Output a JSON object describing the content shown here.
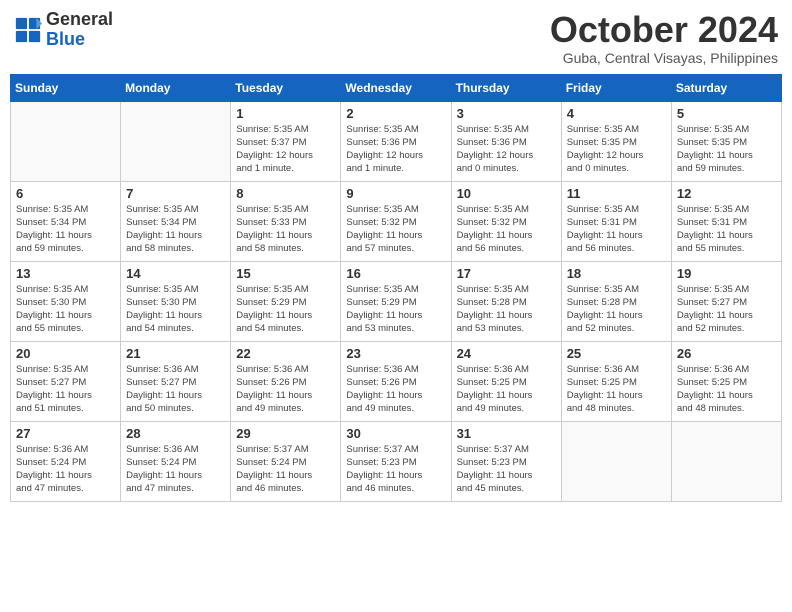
{
  "header": {
    "logo": {
      "general": "General",
      "blue": "Blue"
    },
    "title": "October 2024",
    "subtitle": "Guba, Central Visayas, Philippines"
  },
  "weekdays": [
    "Sunday",
    "Monday",
    "Tuesday",
    "Wednesday",
    "Thursday",
    "Friday",
    "Saturday"
  ],
  "weeks": [
    [
      {
        "day": "",
        "info": ""
      },
      {
        "day": "",
        "info": ""
      },
      {
        "day": "1",
        "info": "Sunrise: 5:35 AM\nSunset: 5:37 PM\nDaylight: 12 hours\nand 1 minute."
      },
      {
        "day": "2",
        "info": "Sunrise: 5:35 AM\nSunset: 5:36 PM\nDaylight: 12 hours\nand 1 minute."
      },
      {
        "day": "3",
        "info": "Sunrise: 5:35 AM\nSunset: 5:36 PM\nDaylight: 12 hours\nand 0 minutes."
      },
      {
        "day": "4",
        "info": "Sunrise: 5:35 AM\nSunset: 5:35 PM\nDaylight: 12 hours\nand 0 minutes."
      },
      {
        "day": "5",
        "info": "Sunrise: 5:35 AM\nSunset: 5:35 PM\nDaylight: 11 hours\nand 59 minutes."
      }
    ],
    [
      {
        "day": "6",
        "info": "Sunrise: 5:35 AM\nSunset: 5:34 PM\nDaylight: 11 hours\nand 59 minutes."
      },
      {
        "day": "7",
        "info": "Sunrise: 5:35 AM\nSunset: 5:34 PM\nDaylight: 11 hours\nand 58 minutes."
      },
      {
        "day": "8",
        "info": "Sunrise: 5:35 AM\nSunset: 5:33 PM\nDaylight: 11 hours\nand 58 minutes."
      },
      {
        "day": "9",
        "info": "Sunrise: 5:35 AM\nSunset: 5:32 PM\nDaylight: 11 hours\nand 57 minutes."
      },
      {
        "day": "10",
        "info": "Sunrise: 5:35 AM\nSunset: 5:32 PM\nDaylight: 11 hours\nand 56 minutes."
      },
      {
        "day": "11",
        "info": "Sunrise: 5:35 AM\nSunset: 5:31 PM\nDaylight: 11 hours\nand 56 minutes."
      },
      {
        "day": "12",
        "info": "Sunrise: 5:35 AM\nSunset: 5:31 PM\nDaylight: 11 hours\nand 55 minutes."
      }
    ],
    [
      {
        "day": "13",
        "info": "Sunrise: 5:35 AM\nSunset: 5:30 PM\nDaylight: 11 hours\nand 55 minutes."
      },
      {
        "day": "14",
        "info": "Sunrise: 5:35 AM\nSunset: 5:30 PM\nDaylight: 11 hours\nand 54 minutes."
      },
      {
        "day": "15",
        "info": "Sunrise: 5:35 AM\nSunset: 5:29 PM\nDaylight: 11 hours\nand 54 minutes."
      },
      {
        "day": "16",
        "info": "Sunrise: 5:35 AM\nSunset: 5:29 PM\nDaylight: 11 hours\nand 53 minutes."
      },
      {
        "day": "17",
        "info": "Sunrise: 5:35 AM\nSunset: 5:28 PM\nDaylight: 11 hours\nand 53 minutes."
      },
      {
        "day": "18",
        "info": "Sunrise: 5:35 AM\nSunset: 5:28 PM\nDaylight: 11 hours\nand 52 minutes."
      },
      {
        "day": "19",
        "info": "Sunrise: 5:35 AM\nSunset: 5:27 PM\nDaylight: 11 hours\nand 52 minutes."
      }
    ],
    [
      {
        "day": "20",
        "info": "Sunrise: 5:35 AM\nSunset: 5:27 PM\nDaylight: 11 hours\nand 51 minutes."
      },
      {
        "day": "21",
        "info": "Sunrise: 5:36 AM\nSunset: 5:27 PM\nDaylight: 11 hours\nand 50 minutes."
      },
      {
        "day": "22",
        "info": "Sunrise: 5:36 AM\nSunset: 5:26 PM\nDaylight: 11 hours\nand 49 minutes."
      },
      {
        "day": "23",
        "info": "Sunrise: 5:36 AM\nSunset: 5:26 PM\nDaylight: 11 hours\nand 49 minutes."
      },
      {
        "day": "24",
        "info": "Sunrise: 5:36 AM\nSunset: 5:25 PM\nDaylight: 11 hours\nand 49 minutes."
      },
      {
        "day": "25",
        "info": "Sunrise: 5:36 AM\nSunset: 5:25 PM\nDaylight: 11 hours\nand 48 minutes."
      },
      {
        "day": "26",
        "info": "Sunrise: 5:36 AM\nSunset: 5:25 PM\nDaylight: 11 hours\nand 48 minutes."
      }
    ],
    [
      {
        "day": "27",
        "info": "Sunrise: 5:36 AM\nSunset: 5:24 PM\nDaylight: 11 hours\nand 47 minutes."
      },
      {
        "day": "28",
        "info": "Sunrise: 5:36 AM\nSunset: 5:24 PM\nDaylight: 11 hours\nand 47 minutes."
      },
      {
        "day": "29",
        "info": "Sunrise: 5:37 AM\nSunset: 5:24 PM\nDaylight: 11 hours\nand 46 minutes."
      },
      {
        "day": "30",
        "info": "Sunrise: 5:37 AM\nSunset: 5:23 PM\nDaylight: 11 hours\nand 46 minutes."
      },
      {
        "day": "31",
        "info": "Sunrise: 5:37 AM\nSunset: 5:23 PM\nDaylight: 11 hours\nand 45 minutes."
      },
      {
        "day": "",
        "info": ""
      },
      {
        "day": "",
        "info": ""
      }
    ]
  ]
}
